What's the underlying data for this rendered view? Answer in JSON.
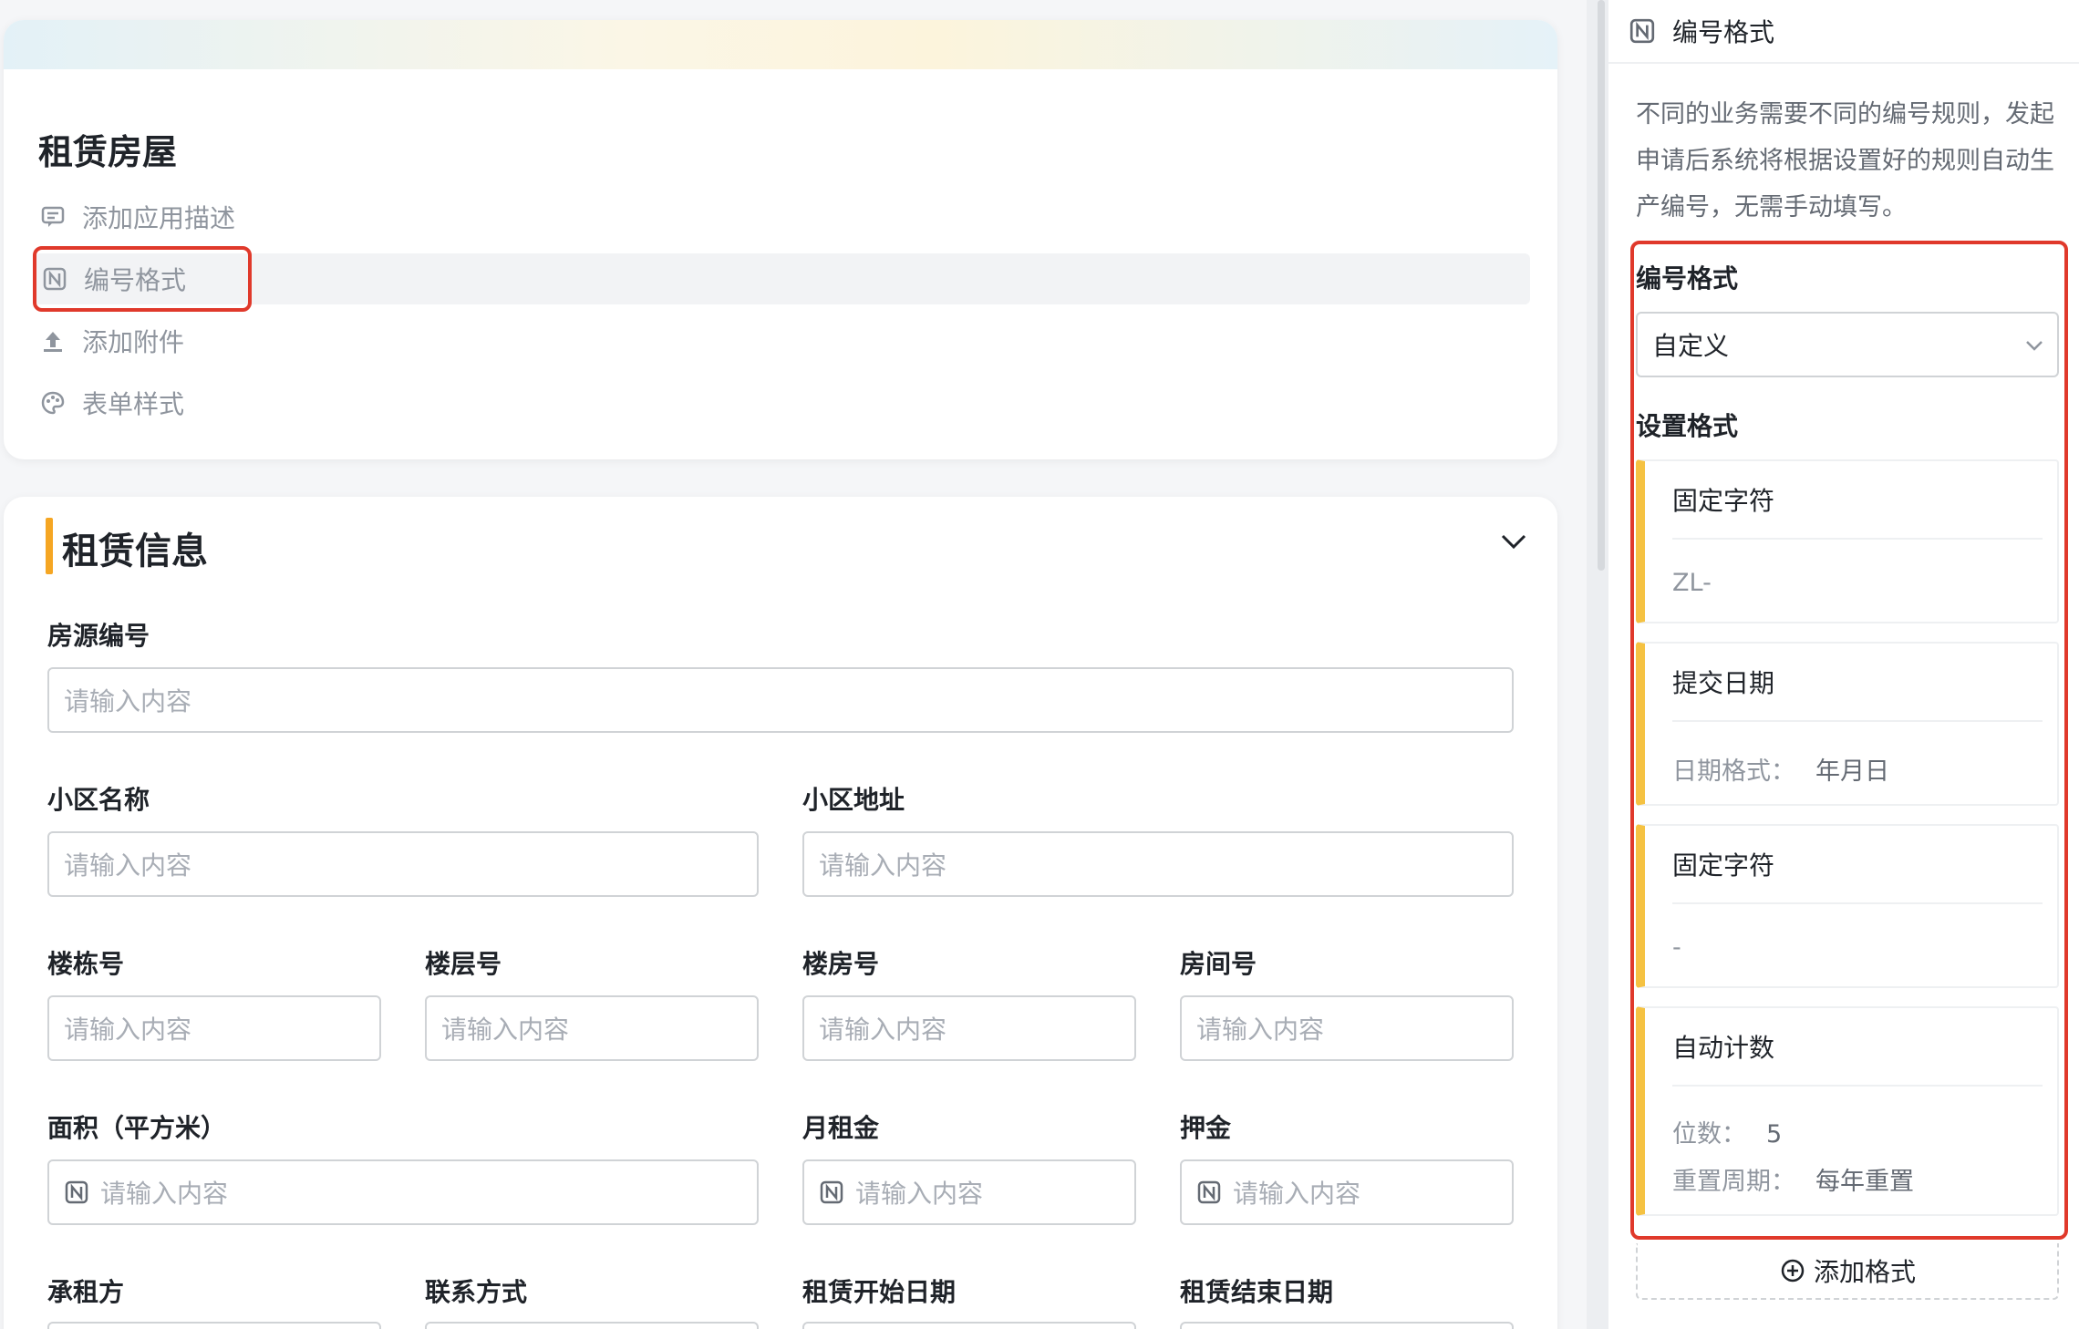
{
  "app": {
    "title": "租赁房屋",
    "menu": [
      {
        "label": "添加应用描述",
        "icon": "comment-icon"
      },
      {
        "label": "编号格式",
        "icon": "number-format-icon"
      },
      {
        "label": "添加附件",
        "icon": "upload-icon"
      },
      {
        "label": "表单样式",
        "icon": "palette-icon"
      }
    ]
  },
  "section": {
    "title": "租赁信息",
    "accent_color": "#f5a623"
  },
  "form": {
    "placeholder": "请输入内容",
    "fields": {
      "house_id": "房源编号",
      "community_name": "小区名称",
      "community_address": "小区地址",
      "building_no": "楼栋号",
      "floor_no": "楼层号",
      "unit_no": "楼房号",
      "room_no": "房间号",
      "area": "面积（平方米）",
      "monthly_rent": "月租金",
      "deposit": "押金",
      "tenant": "承租方",
      "contact": "联系方式",
      "start_date": "租赁开始日期",
      "end_date": "租赁结束日期"
    }
  },
  "panel": {
    "header": "编号格式",
    "description": "不同的业务需要不同的编号规则，发起申请后系统将根据设置好的规则自动生产编号，无需手动填写。",
    "format_label": "编号格式",
    "format_value": "自定义",
    "setting_label": "设置格式",
    "formats": [
      {
        "title": "固定字符",
        "lines": [
          {
            "label": "",
            "value": "ZL-"
          }
        ]
      },
      {
        "title": "提交日期",
        "lines": [
          {
            "label": "日期格式：",
            "value": "年月日"
          }
        ]
      },
      {
        "title": "固定字符",
        "lines": [
          {
            "label": "",
            "value": "-"
          }
        ]
      },
      {
        "title": "自动计数",
        "lines": [
          {
            "label": "位数：",
            "value": "5"
          },
          {
            "label": "重置周期：",
            "value": "每年重置"
          }
        ]
      }
    ],
    "add_format": "添加格式",
    "accent_color": "#f5c242",
    "highlight_color": "#e0392b"
  }
}
